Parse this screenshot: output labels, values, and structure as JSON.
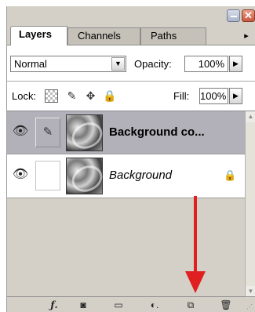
{
  "window": {
    "close_glyph": "✕"
  },
  "tabs": [
    {
      "label": "Layers",
      "active": true
    },
    {
      "label": "Channels",
      "active": false
    },
    {
      "label": "Paths",
      "active": false
    }
  ],
  "tab_menu_glyph": "▸",
  "options": {
    "blend_mode": "Normal",
    "opacity_label": "Opacity:",
    "opacity_value": "100%",
    "lock_label": "Lock:",
    "fill_label": "Fill:",
    "fill_value": "100%"
  },
  "layers": [
    {
      "name": "Background co...",
      "visible": true,
      "selected": true,
      "locked": false
    },
    {
      "name": "Background",
      "visible": true,
      "selected": false,
      "locked": true
    }
  ],
  "icons": {
    "eye": "👁",
    "brush": "✎",
    "move": "✥",
    "lock": "🔒",
    "dropdown": "▼",
    "arrow_right": "▶",
    "scroll_up": "▲",
    "scroll_down": "▼"
  },
  "footer_buttons": [
    {
      "name": "layer-style",
      "glyph": "ƒ."
    },
    {
      "name": "add-mask",
      "glyph": "◙"
    },
    {
      "name": "new-group",
      "glyph": "▭"
    },
    {
      "name": "adjustment-layer",
      "glyph": "◐."
    },
    {
      "name": "new-layer",
      "glyph": "⧉"
    },
    {
      "name": "delete-layer",
      "glyph": "🗑"
    }
  ],
  "colors": {
    "panel_bg": "#d4d0c8",
    "selected_row": "#b2b0b8",
    "annotation_arrow": "#e02020"
  }
}
